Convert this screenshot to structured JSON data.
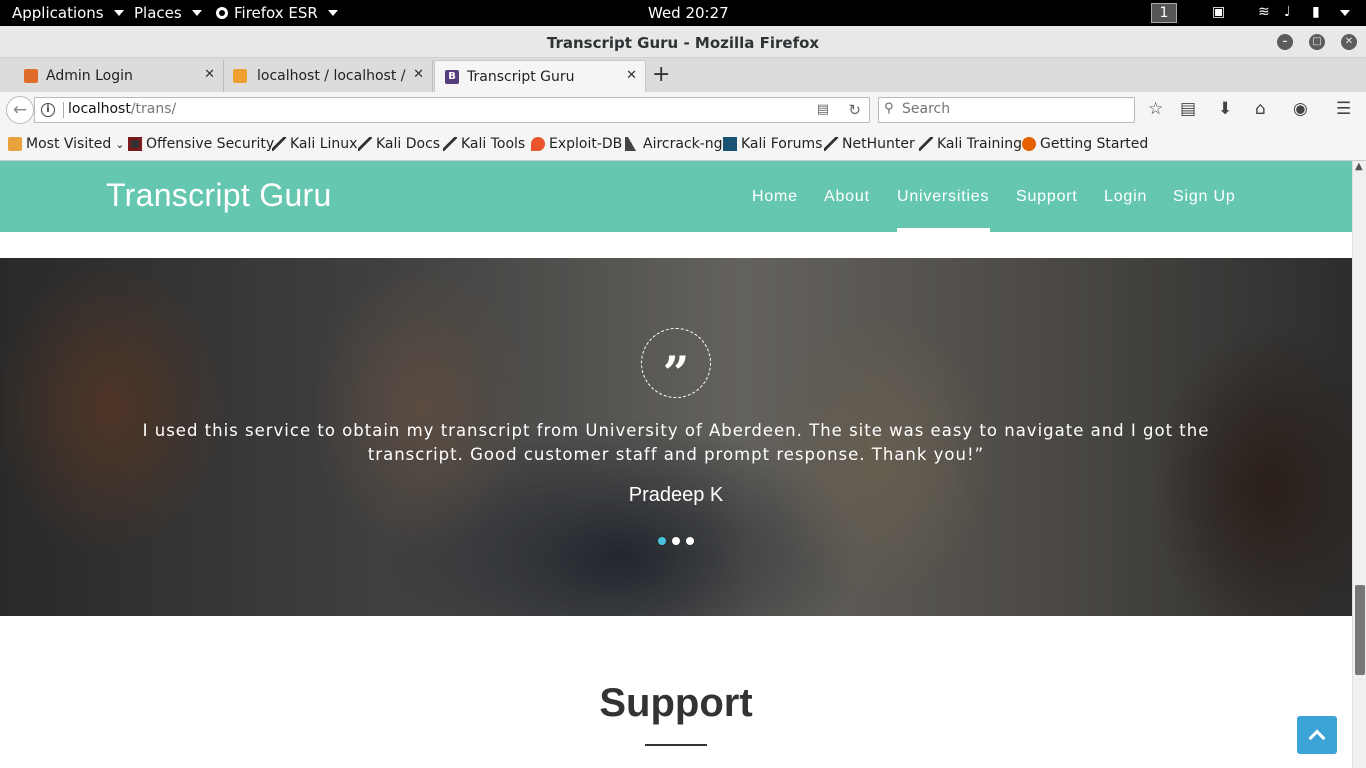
{
  "gnome": {
    "applications": "Applications",
    "places": "Places",
    "browser_menu": "Firefox ESR",
    "clock": "Wed 20:27",
    "workspace": "1"
  },
  "window": {
    "title": "Transcript Guru - Mozilla Firefox"
  },
  "tabs": [
    {
      "label": "Admin Login",
      "active": false,
      "favicon_color": "#e06c2c"
    },
    {
      "label": "localhost / localhost /...",
      "active": false,
      "favicon_color": "#f0a030"
    },
    {
      "label": "Transcript Guru",
      "active": true,
      "favicon_color": "#563d7c"
    }
  ],
  "navbar": {
    "url_host": "localhost",
    "url_path": "/trans/",
    "search_placeholder": "Search"
  },
  "bookmarks": [
    {
      "label": "Most Visited",
      "icon": "folder-icon"
    },
    {
      "label": "Offensive Security",
      "icon": "offsec-icon"
    },
    {
      "label": "Kali Linux",
      "icon": "kali-icon"
    },
    {
      "label": "Kali Docs",
      "icon": "kali-icon"
    },
    {
      "label": "Kali Tools",
      "icon": "kali-icon"
    },
    {
      "label": "Exploit-DB",
      "icon": "exploitdb-icon"
    },
    {
      "label": "Aircrack-ng",
      "icon": "aircrack-icon"
    },
    {
      "label": "Kali Forums",
      "icon": "kali-forums-icon"
    },
    {
      "label": "NetHunter",
      "icon": "kali-icon"
    },
    {
      "label": "Kali Training",
      "icon": "kali-icon"
    },
    {
      "label": "Getting Started",
      "icon": "firefox-icon"
    }
  ],
  "site": {
    "brand": "Transcript Guru",
    "nav": [
      "Home",
      "About",
      "Universities",
      "Support",
      "Login",
      "Sign Up"
    ],
    "active_nav": "Universities",
    "colors": {
      "nav_bg": "#66c7b0",
      "accent": "#48c3de",
      "to_top": "#3ca3d6"
    }
  },
  "testimonial": {
    "quote": "I used this service to obtain my transcript from University of Aberdeen. The site was easy to navigate and I got the transcript. Good customer staff and prompt response. Thank you!”",
    "author": "Pradeep K",
    "slides": 3,
    "active_slide": 1
  },
  "support": {
    "title": "Support"
  }
}
